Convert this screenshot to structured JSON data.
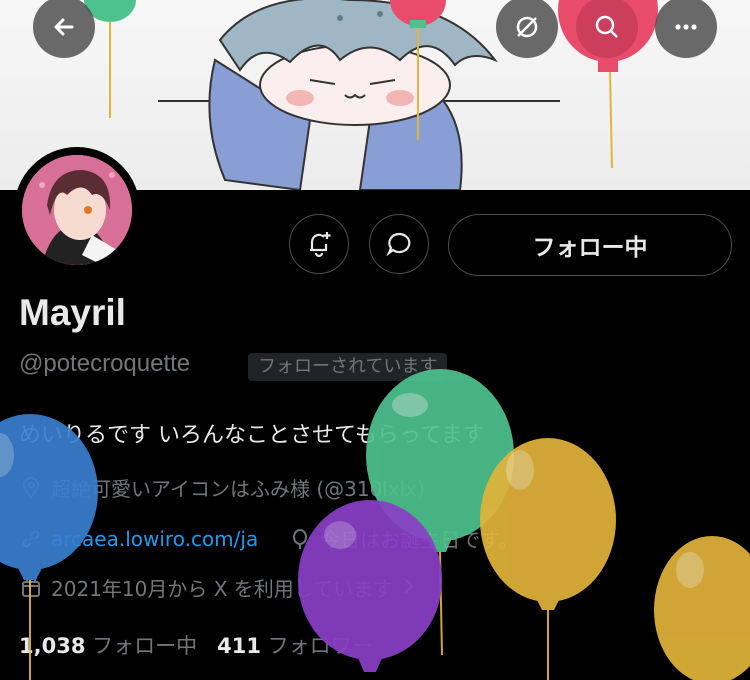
{
  "profile": {
    "display_name": "Mayril",
    "handle": "@potecroquette",
    "follows_you_badge": "フォローされています",
    "bio": "めいりるです いろんなことさせてもらってます",
    "location": "超絶可愛いアイコンはふみ様 (@310lxlx)",
    "website": "arcaea.lowiro.com/ja",
    "birthday": "今日はお誕生日です。",
    "joined": "2021年10月から X を利用しています",
    "following_count": "1,038",
    "following_label": "フォロー中",
    "followers_count": "411",
    "followers_label": "フォロワー"
  },
  "actions": {
    "follow_button_label": "フォロー中"
  },
  "icons": {
    "back": "back-arrow-icon",
    "hide": "eye-off-icon",
    "search": "search-icon",
    "more": "more-icon",
    "notify": "bell-plus-icon",
    "message": "message-icon",
    "location": "location-pin-icon",
    "link": "link-icon",
    "birthday": "balloon-icon",
    "calendar": "calendar-icon"
  },
  "colors": {
    "background": "#000000",
    "text_primary": "#e7e9ea",
    "text_secondary": "#71767b",
    "link": "#1d9bf0",
    "balloon_blue": "#3a7fd0",
    "balloon_green": "#4ec28e",
    "balloon_yellow": "#e2b43a",
    "balloon_purple": "#8a3fc8",
    "balloon_red": "#e94b6a"
  }
}
